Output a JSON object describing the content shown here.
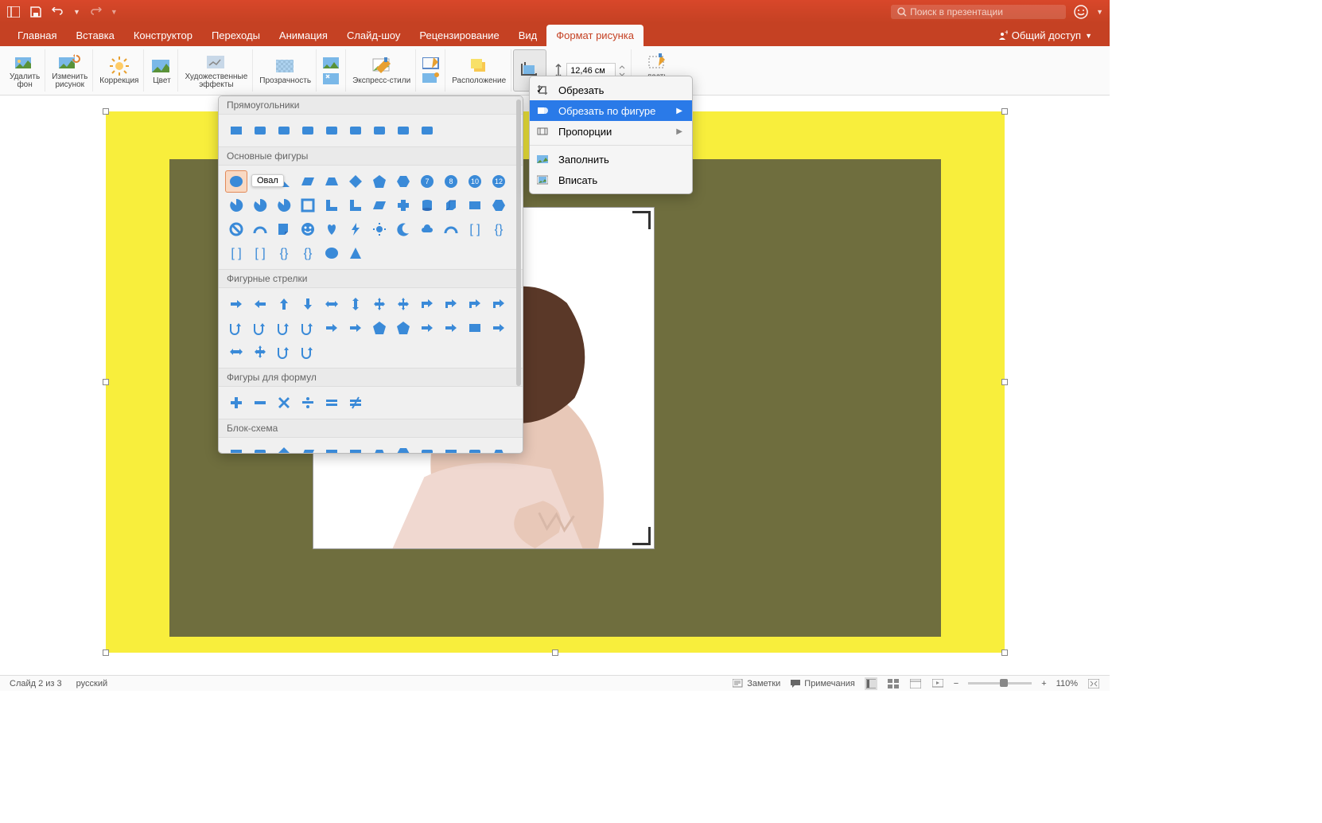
{
  "titlebar": {
    "search_placeholder": "Поиск в презентации"
  },
  "tabs": {
    "items": [
      "Главная",
      "Вставка",
      "Конструктор",
      "Переходы",
      "Анимация",
      "Слайд-шоу",
      "Рецензирование",
      "Вид",
      "Формат рисунка"
    ],
    "active": 8,
    "share": "Общий доступ"
  },
  "ribbon": {
    "remove_bg": "Удалить\nфон",
    "change_pic": "Изменить\nрисунок",
    "correction": "Коррекция",
    "color": "Цвет",
    "artistic": "Художественные\nэффекты",
    "transparency": "Прозрачность",
    "express": "Экспресс-стили",
    "arrange": "Расположение",
    "crop_area": "ласть\nтирования",
    "dimension": "12,46 см"
  },
  "dropdown": {
    "items": [
      {
        "label": "Обрезать",
        "checked": true,
        "icon": "crop"
      },
      {
        "label": "Обрезать по фигуре",
        "highlighted": true,
        "arrow": true,
        "icon": "shape"
      },
      {
        "label": "Пропорции",
        "arrow": true,
        "icon": "ratio"
      },
      {
        "sep": true
      },
      {
        "label": "Заполнить",
        "icon": "fill"
      },
      {
        "label": "Вписать",
        "icon": "fit"
      }
    ]
  },
  "shapes": {
    "tooltip": "Овал",
    "cats": [
      {
        "name": "Прямоугольники",
        "count": 9
      },
      {
        "name": "Основные фигуры",
        "count": 42
      },
      {
        "name": "Фигурные стрелки",
        "count": 28
      },
      {
        "name": "Фигуры для формул",
        "count": 6
      },
      {
        "name": "Блок-схема",
        "count": 24
      }
    ]
  },
  "status": {
    "slide": "Слайд 2 из 3",
    "lang": "русский",
    "notes": "Заметки",
    "comments": "Примечания",
    "zoom": "110%"
  }
}
